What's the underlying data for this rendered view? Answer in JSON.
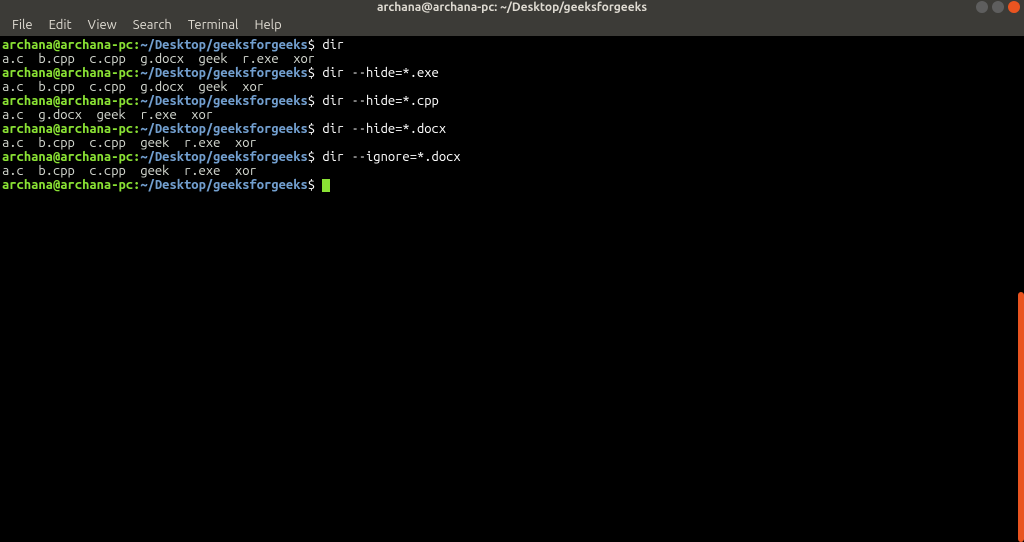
{
  "window": {
    "title": "archana@archana-pc: ~/Desktop/geeksforgeeks"
  },
  "menubar": {
    "items": [
      "File",
      "Edit",
      "View",
      "Search",
      "Terminal",
      "Help"
    ]
  },
  "prompt": {
    "user_host": "archana@archana-pc",
    "colon": ":",
    "path": "~/Desktop/geeksforgeeks",
    "dollar": "$"
  },
  "session": [
    {
      "type": "cmd",
      "text": "dir"
    },
    {
      "type": "output",
      "text": "a.c  b.cpp  c.cpp  g.docx  geek  r.exe  xor"
    },
    {
      "type": "cmd",
      "text": "dir --hide=*.exe"
    },
    {
      "type": "output",
      "text": "a.c  b.cpp  c.cpp  g.docx  geek  xor"
    },
    {
      "type": "cmd",
      "text": "dir --hide=*.cpp"
    },
    {
      "type": "output",
      "text": "a.c  g.docx  geek  r.exe  xor"
    },
    {
      "type": "cmd",
      "text": "dir --hide=*.docx"
    },
    {
      "type": "output",
      "text": "a.c  b.cpp  c.cpp  geek  r.exe  xor"
    },
    {
      "type": "cmd",
      "text": "dir --ignore=*.docx"
    },
    {
      "type": "output",
      "text": "a.c  b.cpp  c.cpp  geek  r.exe  xor"
    },
    {
      "type": "prompt_only"
    }
  ]
}
